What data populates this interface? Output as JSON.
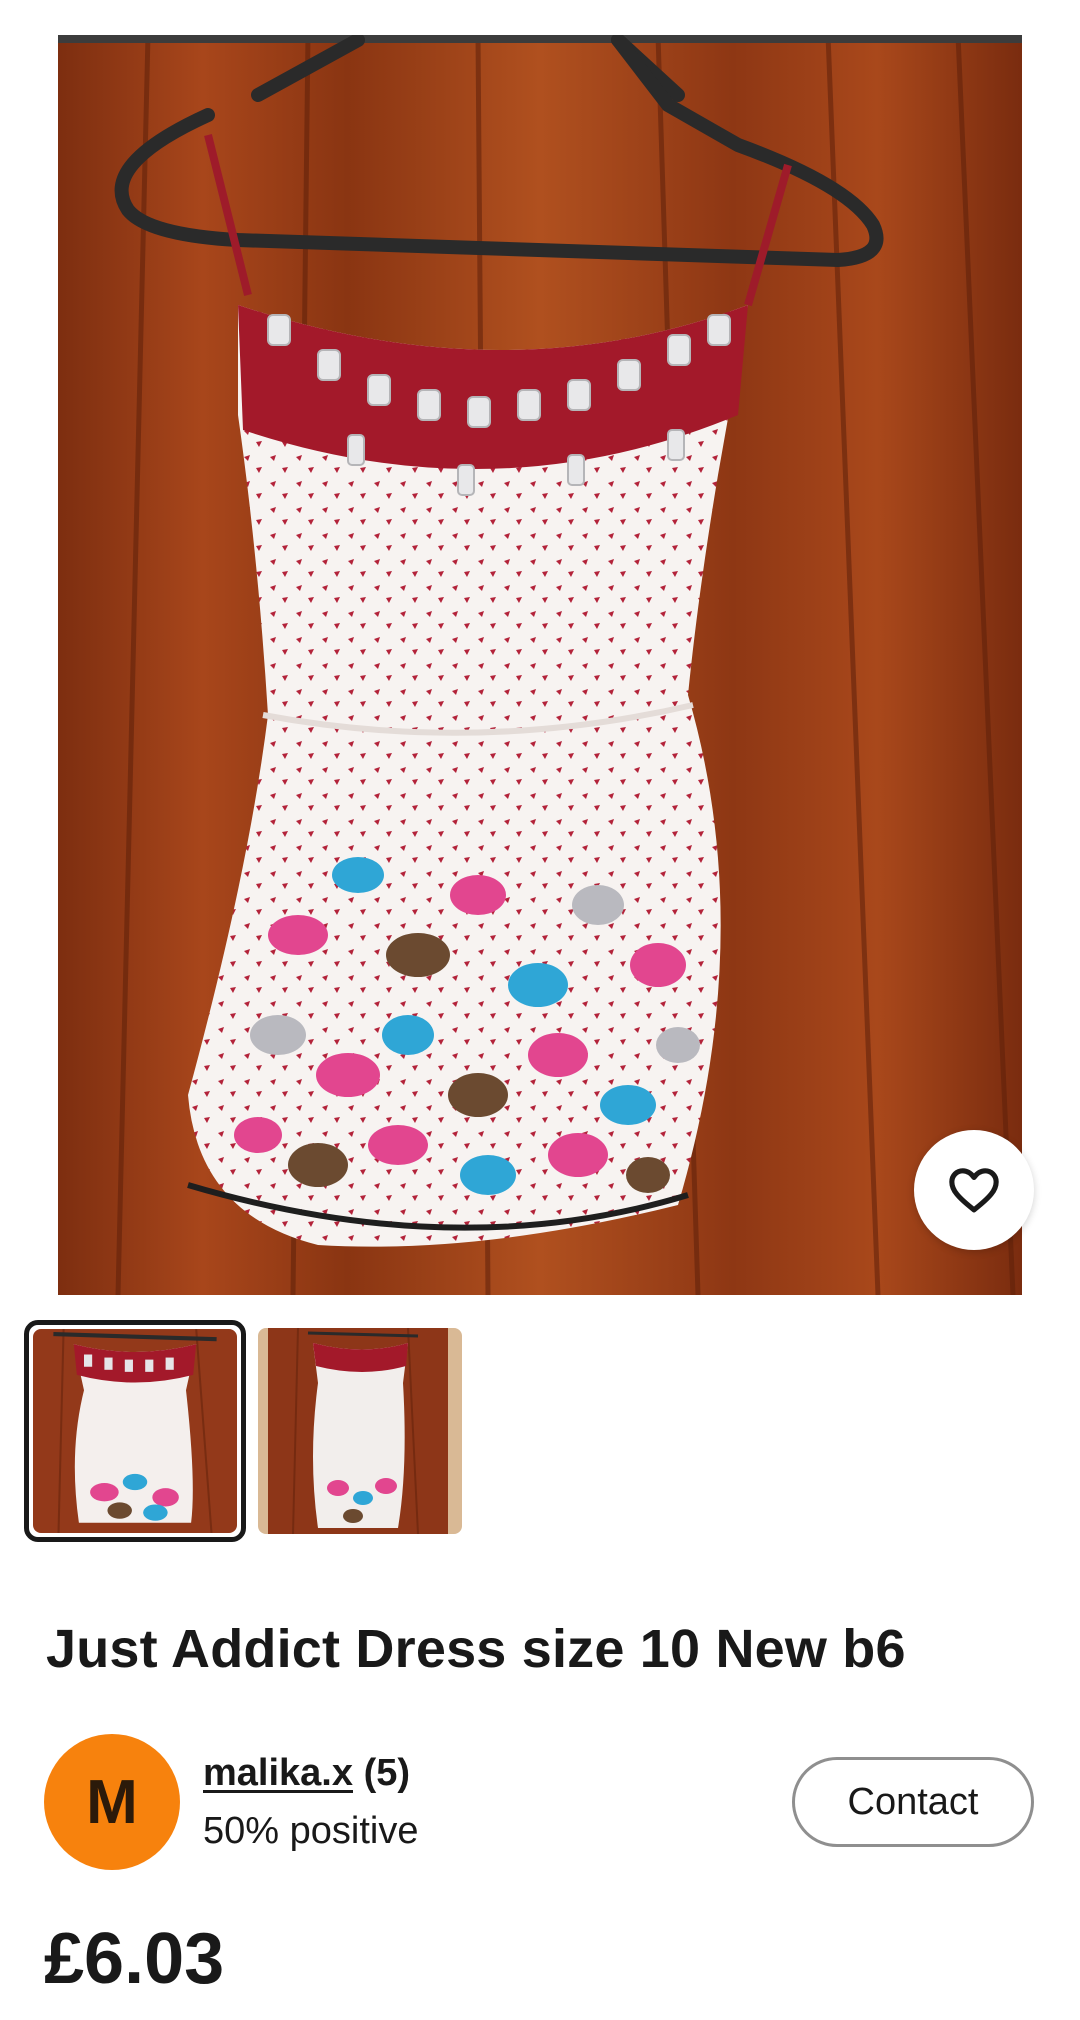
{
  "listing": {
    "title": "Just Addict Dress size 10 New b6",
    "price": "£6.03"
  },
  "gallery": {
    "main_image": "red and white patterned summer dress on hanger against wooden fence",
    "thumbnails": [
      {
        "name": "dress-front-thumbnail",
        "selected": true
      },
      {
        "name": "dress-back-thumbnail",
        "selected": false
      }
    ],
    "watch_icon": "heart-outline-icon"
  },
  "seller": {
    "avatar_letter": "M",
    "avatar_color": "#f7820d",
    "username": "malika.x",
    "feedback_count": "(5)",
    "feedback_text": "50% positive"
  },
  "actions": {
    "contact_label": "Contact"
  }
}
